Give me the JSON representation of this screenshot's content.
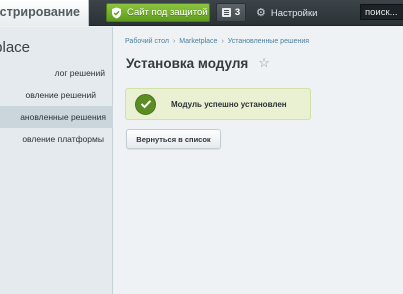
{
  "header": {
    "admin_tab_label": "нистрирование",
    "secure_site_label": "Сайт под защитой",
    "notifications_count": "3",
    "settings_label": "Настройки",
    "search_value": "поиск..."
  },
  "sidebar": {
    "title": "place",
    "items": [
      {
        "label": "лог решений"
      },
      {
        "label": "овление решений"
      },
      {
        "label": "ановленные решения"
      },
      {
        "label": "овление платформы"
      }
    ],
    "active_index": 2
  },
  "main": {
    "breadcrumbs": [
      "Рабочий стол",
      "Marketplace",
      "Установленные решения"
    ],
    "breadcrumb_separator": "›",
    "page_title": "Установка модуля",
    "success_message": "Модуль успешно установлен",
    "back_button_label": "Вернуться в список"
  },
  "colors": {
    "accent_green": "#6aa829",
    "link_blue": "#4c7fa1",
    "success_bg": "#e9f1d2",
    "header_dark": "#2b3236"
  }
}
